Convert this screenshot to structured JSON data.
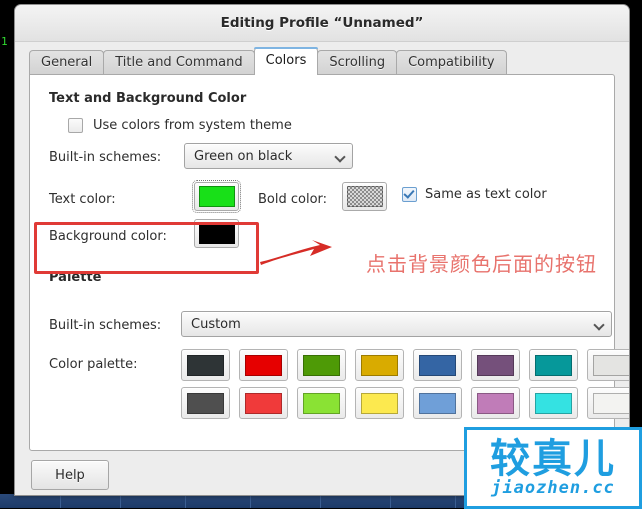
{
  "window": {
    "title": "Editing Profile “Unnamed”"
  },
  "desktop": {
    "terminal_text": "1",
    "taskbar_color": "#1d3a68"
  },
  "tabs": [
    {
      "label": "General",
      "active": false
    },
    {
      "label": "Title and Command",
      "active": false
    },
    {
      "label": "Colors",
      "active": true
    },
    {
      "label": "Scrolling",
      "active": false
    },
    {
      "label": "Compatibility",
      "active": false
    }
  ],
  "text_bg_section": {
    "heading": "Text and Background Color",
    "use_system_theme": {
      "label": "Use colors from system theme",
      "checked": false
    },
    "builtin_schemes": {
      "label": "Built-in schemes:",
      "value": "Green on black"
    },
    "text_color": {
      "label": "Text color:",
      "value": "#18e018"
    },
    "bold_color": {
      "label": "Bold color:",
      "value": "checkerboard"
    },
    "same_as_text_color": {
      "label": "Same as text color",
      "checked": true
    },
    "background_color": {
      "label": "Background color:",
      "value": "#000000"
    }
  },
  "palette_section": {
    "heading": "Palette",
    "builtin_schemes": {
      "label": "Built-in schemes:",
      "value": "Custom"
    },
    "color_palette": {
      "label": "Color palette:",
      "row1": [
        "#2e3436",
        "#e60000",
        "#4e9a06",
        "#d9ab00",
        "#3465a4",
        "#75507b",
        "#06989a",
        "#e4e4e2"
      ],
      "row2": [
        "#4f4f4f",
        "#f03a3a",
        "#8ae234",
        "#fce94f",
        "#6f9fd8",
        "#c07cb8",
        "#34e2e2",
        "#f3f3f1"
      ]
    }
  },
  "footer": {
    "help_label": "Help"
  },
  "annotations": {
    "highlight_color": "#e03a36",
    "arrow_color": "#d62c26",
    "note_text": "点击背景颜色后面的按钮",
    "note_color": "#e8736d"
  },
  "watermark": {
    "cn": "较真儿",
    "en": "jiaozhen.cc",
    "color": "#1f9ee0"
  }
}
